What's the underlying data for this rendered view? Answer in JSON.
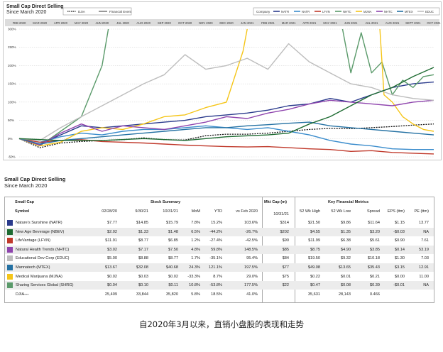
{
  "chart": {
    "title_line1": "Small Cap Direct Selling",
    "title_line2": "Since March 2020",
    "legend_left": [
      {
        "label": "DJIA",
        "color": "#111111",
        "dash": true
      },
      {
        "label": "Financial Event",
        "color": "#555555",
        "dash": false
      }
    ],
    "legend_company_label": "Company",
    "legend_right": [
      {
        "label": "NATR",
        "color": "#2a3a8c"
      },
      {
        "label": "NATR",
        "color": "#3a8ccc"
      },
      {
        "label": "LFVN",
        "color": "#c0392b"
      },
      {
        "label": "NHTC",
        "color": "#5a9a6a"
      },
      {
        "label": "MJNA",
        "color": "#f5c518"
      },
      {
        "label": "NHTC",
        "color": "#8e44ad"
      },
      {
        "label": "MTEX",
        "color": "#2471a3"
      },
      {
        "label": "EDUC",
        "color": "#c0c0c0"
      }
    ]
  },
  "chart_data": {
    "type": "line",
    "x_ticks": [
      "FEB 2020",
      "MAR 2020",
      "APR 2020",
      "MAY 2020",
      "JUN 2020",
      "JUL 2020",
      "AUG 2020",
      "SEP 2020",
      "OCT 2020",
      "NOV 2020",
      "DEC 2020",
      "JAN 2021",
      "FEB 2021",
      "MAR 2021",
      "APR 2021",
      "MAY 2021",
      "JUN 2021",
      "JUL 2021",
      "AUG 2021",
      "SEPT 2021",
      "OCT 2021"
    ],
    "y_ticks": [
      "300%",
      "250%",
      "200%",
      "150%",
      "100%",
      "50%",
      "0%",
      "-50%"
    ],
    "ylim": [
      -50,
      300
    ],
    "xlim": [
      0,
      20
    ],
    "series": [
      {
        "name": "DJIA",
        "color": "#111111",
        "dash": true,
        "points": [
          [
            0,
            0
          ],
          [
            1,
            -25
          ],
          [
            2,
            -12
          ],
          [
            3,
            -8
          ],
          [
            4,
            -5
          ],
          [
            5,
            -3
          ],
          [
            6,
            2
          ],
          [
            7,
            -3
          ],
          [
            8,
            -4
          ],
          [
            9,
            8
          ],
          [
            10,
            12
          ],
          [
            11,
            12
          ],
          [
            12,
            15
          ],
          [
            13,
            20
          ],
          [
            14,
            25
          ],
          [
            15,
            28
          ],
          [
            16,
            27
          ],
          [
            17,
            30
          ],
          [
            18,
            33
          ],
          [
            19,
            37
          ],
          [
            20,
            40
          ]
        ]
      },
      {
        "name": "NATR",
        "color": "#2a3a8c",
        "points": [
          [
            0,
            0
          ],
          [
            1,
            -15
          ],
          [
            2,
            10
          ],
          [
            3,
            35
          ],
          [
            4,
            30
          ],
          [
            5,
            35
          ],
          [
            6,
            40
          ],
          [
            7,
            45
          ],
          [
            8,
            50
          ],
          [
            9,
            60
          ],
          [
            10,
            65
          ],
          [
            11,
            70
          ],
          [
            12,
            78
          ],
          [
            13,
            90
          ],
          [
            14,
            95
          ],
          [
            15,
            110
          ],
          [
            16,
            100
          ],
          [
            17,
            120
          ],
          [
            18,
            140
          ],
          [
            19,
            150
          ],
          [
            20,
            155
          ]
        ]
      },
      {
        "name": "NAII",
        "color": "#3a8ccc",
        "points": [
          [
            0,
            0
          ],
          [
            1,
            -10
          ],
          [
            2,
            5
          ],
          [
            3,
            15
          ],
          [
            4,
            10
          ],
          [
            5,
            20
          ],
          [
            6,
            25
          ],
          [
            7,
            25
          ],
          [
            8,
            30
          ],
          [
            9,
            35
          ],
          [
            10,
            30
          ],
          [
            11,
            25
          ],
          [
            12,
            30
          ],
          [
            13,
            20
          ],
          [
            14,
            10
          ],
          [
            15,
            -5
          ],
          [
            16,
            -15
          ],
          [
            17,
            -20
          ],
          [
            18,
            -28
          ],
          [
            19,
            -30
          ],
          [
            20,
            -30
          ]
        ]
      },
      {
        "name": "LFVN",
        "color": "#c0392b",
        "points": [
          [
            0,
            0
          ],
          [
            1,
            -10
          ],
          [
            2,
            -5
          ],
          [
            3,
            -3
          ],
          [
            4,
            -8
          ],
          [
            5,
            -10
          ],
          [
            6,
            -12
          ],
          [
            7,
            -15
          ],
          [
            8,
            -18
          ],
          [
            9,
            -20
          ],
          [
            10,
            -22
          ],
          [
            11,
            -23
          ],
          [
            12,
            -22
          ],
          [
            13,
            -25
          ],
          [
            14,
            -28
          ],
          [
            15,
            -30
          ],
          [
            16,
            -35
          ],
          [
            17,
            -33
          ],
          [
            18,
            -38
          ],
          [
            19,
            -40
          ],
          [
            20,
            -42
          ]
        ]
      },
      {
        "name": "NHTC",
        "color": "#5a9a6a",
        "points": [
          [
            0,
            0
          ],
          [
            1,
            -20
          ],
          [
            2,
            20
          ],
          [
            3,
            60
          ],
          [
            4,
            200
          ],
          [
            4.3,
            300
          ]
        ]
      },
      {
        "name": "NHTC-2",
        "color": "#5a9a6a",
        "points": [
          [
            15.6,
            300
          ],
          [
            16,
            180
          ],
          [
            16.5,
            290
          ],
          [
            17,
            180
          ],
          [
            17.5,
            210
          ],
          [
            18,
            120
          ],
          [
            18.5,
            160
          ],
          [
            19,
            140
          ],
          [
            19.5,
            170
          ],
          [
            20,
            175
          ]
        ]
      },
      {
        "name": "MJNA",
        "color": "#f5c518",
        "points": [
          [
            0,
            0
          ],
          [
            1,
            -20
          ],
          [
            2,
            -10
          ],
          [
            3,
            20
          ],
          [
            4,
            30
          ],
          [
            5,
            25
          ],
          [
            6,
            40
          ],
          [
            7,
            60
          ],
          [
            8,
            65
          ],
          [
            9,
            85
          ],
          [
            10,
            100
          ],
          [
            10.8,
            240
          ],
          [
            11,
            300
          ]
        ]
      },
      {
        "name": "MJNA-2",
        "color": "#f5c518",
        "points": [
          [
            17.4,
            300
          ],
          [
            17.6,
            120
          ],
          [
            18,
            100
          ],
          [
            18.5,
            60
          ],
          [
            19,
            40
          ],
          [
            19.5,
            25
          ],
          [
            20,
            20
          ]
        ]
      },
      {
        "name": "NATH",
        "color": "#8e44ad",
        "points": [
          [
            0,
            0
          ],
          [
            1,
            -18
          ],
          [
            2,
            15
          ],
          [
            3,
            40
          ],
          [
            4,
            20
          ],
          [
            5,
            35
          ],
          [
            6,
            30
          ],
          [
            7,
            25
          ],
          [
            8,
            35
          ],
          [
            9,
            45
          ],
          [
            10,
            60
          ],
          [
            11,
            55
          ],
          [
            12,
            70
          ],
          [
            13,
            80
          ],
          [
            14,
            95
          ],
          [
            15,
            105
          ],
          [
            16,
            100
          ],
          [
            17,
            95
          ],
          [
            18,
            90
          ],
          [
            19,
            100
          ],
          [
            20,
            105
          ]
        ]
      },
      {
        "name": "MTEX",
        "color": "#2471a3",
        "points": [
          [
            0,
            0
          ],
          [
            1,
            -15
          ],
          [
            2,
            -5
          ],
          [
            3,
            0
          ],
          [
            4,
            5
          ],
          [
            5,
            10
          ],
          [
            6,
            15
          ],
          [
            7,
            20
          ],
          [
            8,
            25
          ],
          [
            9,
            30
          ],
          [
            10,
            30
          ],
          [
            11,
            35
          ],
          [
            12,
            38
          ],
          [
            13,
            42
          ],
          [
            14,
            45
          ],
          [
            15,
            35
          ],
          [
            16,
            30
          ],
          [
            17,
            25
          ],
          [
            18,
            20
          ],
          [
            19,
            15
          ],
          [
            20,
            10
          ]
        ]
      },
      {
        "name": "EDUC",
        "color": "#bdbdbd",
        "points": [
          [
            0,
            0
          ],
          [
            1,
            -5
          ],
          [
            2,
            30
          ],
          [
            3,
            60
          ],
          [
            4,
            90
          ],
          [
            5,
            120
          ],
          [
            6,
            150
          ],
          [
            7,
            175
          ],
          [
            8,
            230
          ],
          [
            9,
            190
          ],
          [
            10,
            200
          ],
          [
            11,
            220
          ],
          [
            12,
            190
          ],
          [
            13,
            260
          ],
          [
            14,
            210
          ],
          [
            15,
            180
          ],
          [
            16,
            150
          ],
          [
            17,
            140
          ],
          [
            18,
            120
          ],
          [
            19,
            110
          ],
          [
            20,
            105
          ]
        ]
      },
      {
        "name": "MOFF",
        "color": "#1e6b32",
        "points": [
          [
            0,
            0
          ],
          [
            2,
            -5
          ],
          [
            4,
            -5
          ],
          [
            6,
            0
          ],
          [
            8,
            -5
          ],
          [
            10,
            5
          ],
          [
            12,
            10
          ],
          [
            13,
            15
          ],
          [
            14,
            40
          ],
          [
            15,
            60
          ],
          [
            16,
            90
          ],
          [
            17,
            120
          ],
          [
            18,
            140
          ],
          [
            19,
            170
          ],
          [
            20,
            195
          ]
        ]
      }
    ]
  },
  "table": {
    "title_line1": "Small Cap Direct Selling",
    "title_line2": "Since March 2020",
    "group_headers": {
      "small_cap": "Small Cap",
      "stock_summary": "Stock Summary",
      "mkt_cap": "Mkt Cap (m)",
      "key_metrics": "Key Financial Metrics"
    },
    "columns": {
      "symbol": "Symbol",
      "c1": "02/28/20",
      "c2": "9/30/21",
      "c3": "10/31/21",
      "c4": "MoM",
      "c5": "YTD",
      "c6": "vs Feb 2020",
      "c7": "10/31/21",
      "c8": "52 Wk High",
      "c9": "52 Wk Low",
      "c10": "Spread",
      "c11": "EPS (ttm)",
      "c12": "PE (ttm)"
    },
    "rows": [
      {
        "name": "Nature's Sunshine (NATR)",
        "color": "#2a3a8c",
        "v": [
          "$7.77",
          "$14.85",
          "$15.79",
          "7.8%",
          "15.2%",
          "103.6%",
          "$314",
          "$21.50",
          "$9.86",
          "$11.64",
          "$1.15",
          "13.77"
        ]
      },
      {
        "name": "New Age Beverage (NBEV)",
        "color": "#1e6b32",
        "v": [
          "$2.02",
          "$1.33",
          "$1.48",
          "6.5%",
          "-44.2%",
          "-26.7%",
          "$202",
          "$4.55",
          "$1.35",
          "$3.20",
          "-$0.03",
          "NA"
        ]
      },
      {
        "name": "LifeVantage (LFVN)",
        "color": "#c0392b",
        "v": [
          "$11.91",
          "$8.77",
          "$6.85",
          "1.2%",
          "-27.4%",
          "-42.5%",
          "$90",
          "$11.99",
          "$6.38",
          "$5.61",
          "$0.90",
          "7.61"
        ]
      },
      {
        "name": "Natural Health Trends (NHTC)",
        "color": "#8e44ad",
        "v": [
          "$3.02",
          "$7.17",
          "$7.50",
          "4.8%",
          "59.8%",
          "148.5%",
          "$85",
          "$8.75",
          "$4.90",
          "$3.85",
          "$0.14",
          "53.19"
        ]
      },
      {
        "name": "Educational Dev Corp (EDUC)",
        "color": "#bdbdbd",
        "v": [
          "$5.00",
          "$8.88",
          "$8.77",
          "1.7%",
          "-35.1%",
          "95.4%",
          "$84",
          "$19.50",
          "$9.32",
          "$10.18",
          "$1.30",
          "7.03"
        ]
      },
      {
        "name": "Mannatech (MTEX)",
        "color": "#2471a3",
        "v": [
          "$13.67",
          "$32.08",
          "$40.68",
          "24.3%",
          "121.1%",
          "197.5%",
          "$77",
          "$49.08",
          "$13.65",
          "$35.43",
          "$3.15",
          "12.91"
        ]
      },
      {
        "name": "Medical Marijuana (MJNA)",
        "color": "#f5c518",
        "v": [
          "$0.02",
          "$0.03",
          "$0.02",
          "-33.3%",
          "8.7%",
          "29.0%",
          "$75",
          "$0.22",
          "$0.01",
          "$0.21",
          "$0.00",
          "11.00"
        ]
      },
      {
        "name": "Sharing Services Global (SHRG)",
        "color": "#5a9a6a",
        "v": [
          "$0.04",
          "$0.10",
          "$0.11",
          "10.8%",
          "-53.8%",
          "177.5%",
          "$22",
          "$0.47",
          "$0.08",
          "$0.39",
          "-$0.01",
          "NA"
        ]
      },
      {
        "name": "DJIA",
        "color": "",
        "dashmark": "----",
        "v": [
          "25,409",
          "33,844",
          "35,820",
          "5.8%",
          "18.5%",
          "41.0%",
          "",
          "35,631",
          "28,143",
          "0.466",
          "",
          ""
        ]
      }
    ]
  },
  "caption": "自2020年3月以来，直销小盘股的表现和走势"
}
